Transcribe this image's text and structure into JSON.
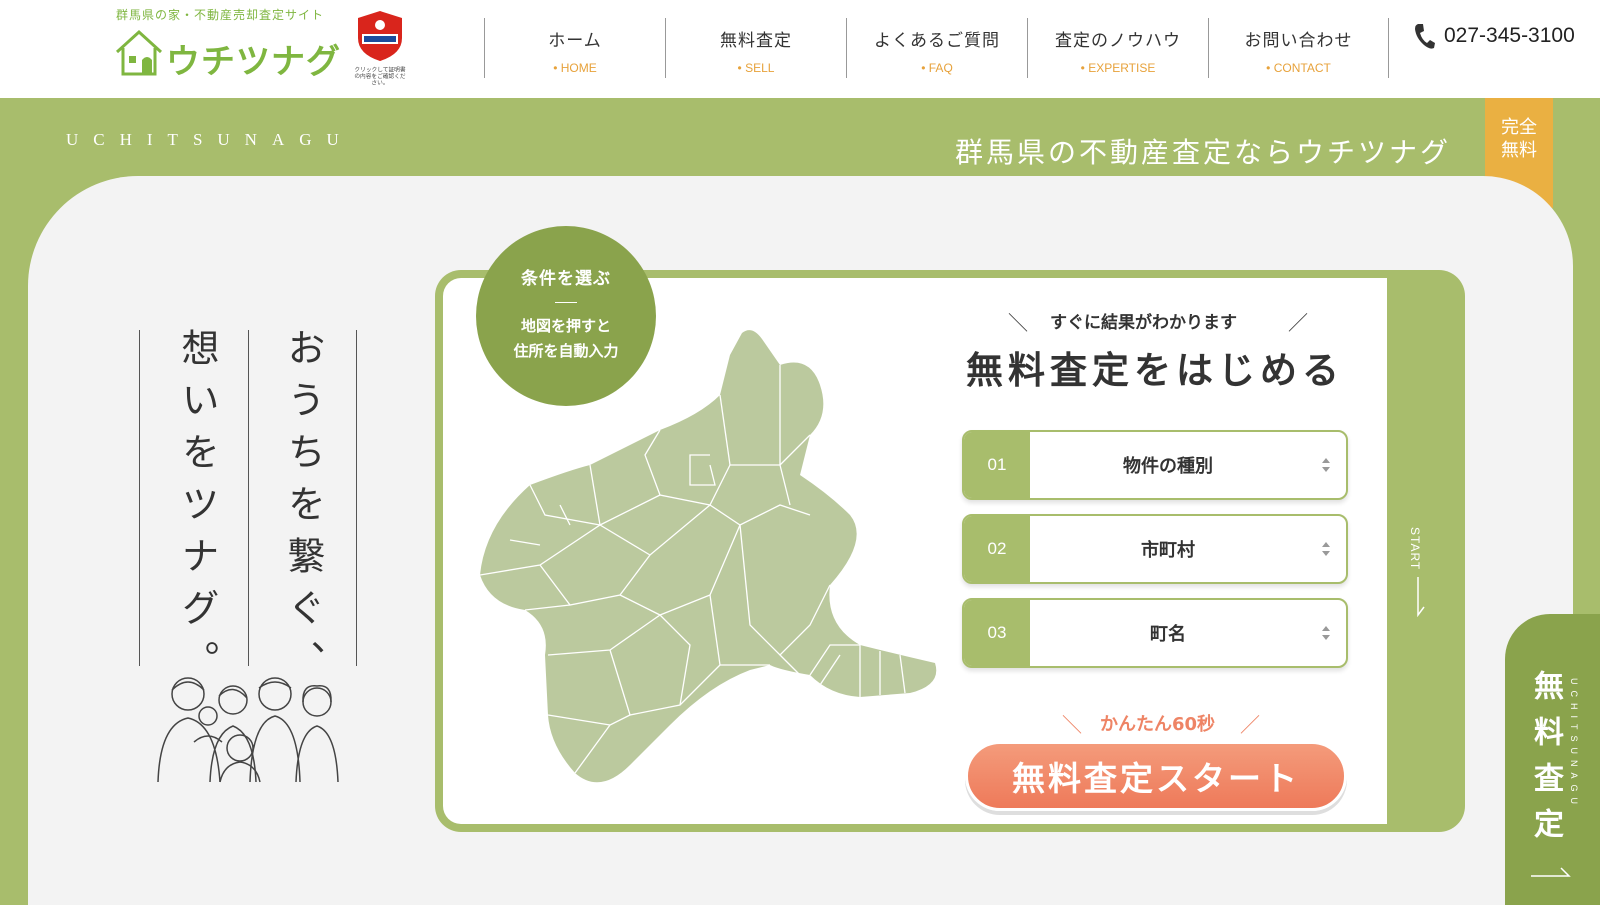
{
  "header": {
    "logo_tagline": "群馬県の家・不動産売却査定サイト",
    "logo_name": "ウチツナグ",
    "secom_note": "クリックして証明書の内容をご確認ください。",
    "nav": [
      {
        "jp": "ホーム",
        "en": "HOME"
      },
      {
        "jp": "無料査定",
        "en": "SELL"
      },
      {
        "jp": "よくあるご質問",
        "en": "FAQ"
      },
      {
        "jp": "査定のノウハウ",
        "en": "EXPERTISE"
      },
      {
        "jp": "お問い合わせ",
        "en": "CONTACT"
      }
    ],
    "phone": "027-345-3100"
  },
  "band": {
    "brand_en": "UCHITSUNAGU",
    "title": "群馬県の不動産査定ならウチツナグ",
    "ribbon": "完全\n無料"
  },
  "hero": {
    "copy_line1": "おうちを繋ぐ、",
    "copy_line2": "想いをツナグ。"
  },
  "map_card": {
    "badge_title": "条件を選ぶ",
    "badge_desc_1": "地図を押すと",
    "badge_desc_2": "住所を自動入力",
    "lead": "すぐに結果がわかります",
    "headline": "無料査定をはじめる",
    "selects": [
      {
        "num": "01",
        "label": "物件の種別"
      },
      {
        "num": "02",
        "label": "市町村"
      },
      {
        "num": "03",
        "label": "町名"
      }
    ],
    "easy": "かんたん60秒",
    "cta": "無料査定スタート",
    "start": "START"
  },
  "side_tab": {
    "label": "無料査定",
    "en": "UCHITSUNAGU"
  },
  "colors": {
    "green": "#a8bd6c",
    "dark_green": "#8aa34c",
    "orange": "#eab042",
    "coral": "#ee7a5a"
  }
}
